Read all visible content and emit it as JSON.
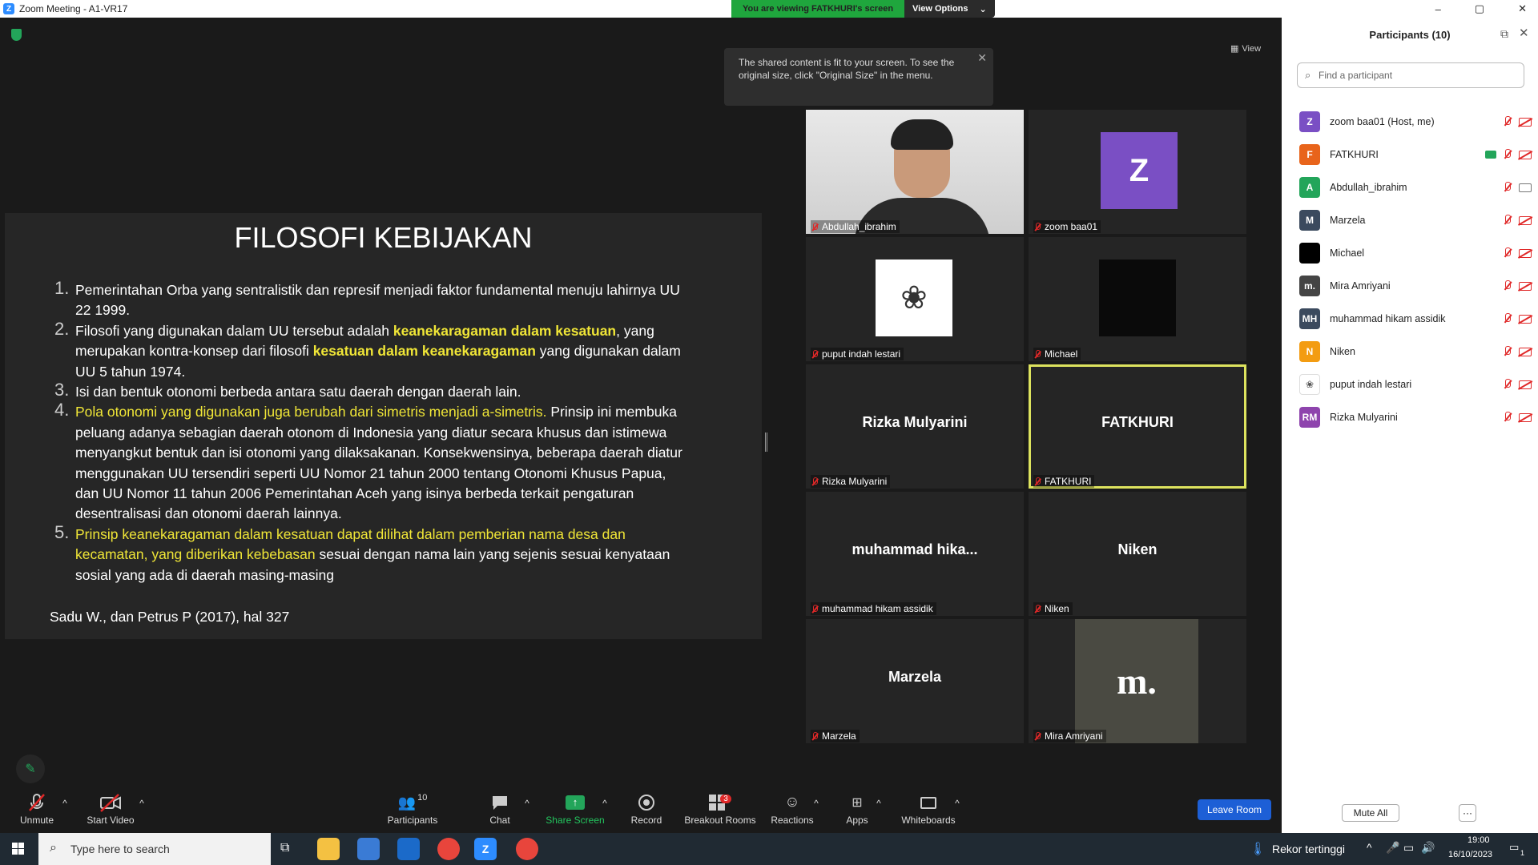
{
  "window": {
    "title": "Zoom Meeting - A1-VR17",
    "controls": {
      "minimize": "–",
      "restore": "▢",
      "close": "✕"
    }
  },
  "share_banner": {
    "status": "You are viewing FATKHURI's screen",
    "view_options": "View Options"
  },
  "tooltip": {
    "text": "The shared content is fit to your screen. To see the original size, click \"Original Size\" in the menu."
  },
  "view_button": "View",
  "slide": {
    "title": "FILOSOFI KEBIJAKAN",
    "items": [
      {
        "num": "1.",
        "segments": [
          {
            "t": "Pemerintahan Orba yang sentralistik dan represif menjadi faktor fundamental menuju lahirnya UU 22 1999.",
            "s": ""
          }
        ]
      },
      {
        "num": "2.",
        "segments": [
          {
            "t": "Filosofi yang digunakan dalam UU tersebut adalah ",
            "s": ""
          },
          {
            "t": "keanekaragaman dalam kesatuan",
            "s": "yb"
          },
          {
            "t": ", yang merupakan kontra-konsep dari filosofi ",
            "s": ""
          },
          {
            "t": "kesatuan dalam keanekaragaman",
            "s": "yb"
          },
          {
            "t": " yang digunakan dalam UU 5 tahun 1974.",
            "s": ""
          }
        ]
      },
      {
        "num": "3.",
        "segments": [
          {
            "t": "Isi dan bentuk otonomi berbeda antara satu daerah dengan daerah lain.",
            "s": ""
          }
        ]
      },
      {
        "num": "4.",
        "segments": [
          {
            "t": "Pola otonomi yang digunakan juga berubah dari simetris menjadi a-simetris.",
            "s": "y"
          },
          {
            "t": " Prinsip ini membuka peluang adanya sebagian daerah otonom di Indonesia yang diatur secara khusus dan istimewa menyangkut bentuk dan isi otonomi yang dilaksakanan.  Konsekwensinya, beberapa daerah diatur menggunakan UU tersendiri seperti UU Nomor 21 tahun 2000 tentang Otonomi Khusus Papua, dan UU Nomor 11 tahun 2006 Pemerintahan Aceh yang isinya berbeda terkait pengaturan desentralisasi dan otonomi daerah lainnya.",
            "s": ""
          }
        ]
      },
      {
        "num": "5.",
        "segments": [
          {
            "t": "Prinsip keanekaragaman dalam kesatuan dapat dilihat dalam pemberian nama desa dan kecamatan, yang diberikan kebebasan",
            "s": "y"
          },
          {
            "t": " sesuai dengan nama lain yang sejenis sesuai kenyataan sosial yang ada di daerah masing-masing",
            "s": ""
          }
        ]
      }
    ],
    "reference": "Sadu W., dan Petrus P (2017), hal 327"
  },
  "video_tiles": [
    {
      "id": "abdullah",
      "label": "Abdullah_ibrahim",
      "big": "",
      "type": "camera"
    },
    {
      "id": "zoom",
      "label": "zoom baa01",
      "big": "Z",
      "type": "avatar",
      "color": "#7a4fc4"
    },
    {
      "id": "puput",
      "label": "puput indah lestari",
      "big": "",
      "type": "image"
    },
    {
      "id": "michael",
      "label": "Michael",
      "big": "",
      "type": "black"
    },
    {
      "id": "rizka",
      "label": "Rizka Mulyarini",
      "big": "Rizka Mulyarini",
      "type": "name"
    },
    {
      "id": "fatkhuri",
      "label": "FATKHURI",
      "big": "FATKHURI",
      "type": "name"
    },
    {
      "id": "hikam",
      "label": "muhammad hikam assidik",
      "big": "muhammad  hika...",
      "type": "name"
    },
    {
      "id": "niken",
      "label": "Niken",
      "big": "Niken",
      "type": "name"
    },
    {
      "id": "marzela",
      "label": "Marzela",
      "big": "Marzela",
      "type": "name"
    },
    {
      "id": "mira",
      "label": "Mira Amriyani",
      "big": "",
      "type": "logo"
    }
  ],
  "toolbar": {
    "unmute": "Unmute",
    "start_video": "Start Video",
    "participants": "Participants",
    "participants_count": "10",
    "chat": "Chat",
    "share_screen": "Share Screen",
    "record": "Record",
    "breakout_rooms": "Breakout Rooms",
    "breakout_badge": "3",
    "reactions": "Reactions",
    "apps": "Apps",
    "whiteboards": "Whiteboards",
    "leave": "Leave Room"
  },
  "sidebar": {
    "title": "Participants (10)",
    "search_placeholder": "Find a participant",
    "mute_all": "Mute All",
    "more": "···",
    "participants": [
      {
        "initial": "Z",
        "name": "zoom baa01 (Host, me)",
        "color": "#7a4fc4",
        "cam": "off",
        "share": false
      },
      {
        "initial": "F",
        "name": "FATKHURI",
        "color": "#e8641b",
        "cam": "off",
        "share": true
      },
      {
        "initial": "A",
        "name": "Abdullah_ibrahim",
        "color": "#23a55a",
        "cam": "on",
        "share": false
      },
      {
        "initial": "M",
        "name": "Marzela",
        "color": "#3b4a5e",
        "cam": "off",
        "share": false
      },
      {
        "initial": "",
        "name": "Michael",
        "color": "#000000",
        "cam": "off",
        "share": false
      },
      {
        "initial": "m.",
        "name": "Mira Amriyani",
        "color": "#444444",
        "cam": "off",
        "share": false
      },
      {
        "initial": "MH",
        "name": "muhammad hikam assidik",
        "color": "#3b4a5e",
        "cam": "off",
        "share": false
      },
      {
        "initial": "N",
        "name": "Niken",
        "color": "#f39c12",
        "cam": "off",
        "share": false
      },
      {
        "initial": "",
        "name": "puput indah lestari",
        "color": "#ffffff",
        "cam": "off",
        "share": false
      },
      {
        "initial": "RM",
        "name": "Rizka Mulyarini",
        "color": "#8e44ad",
        "cam": "off",
        "share": false
      }
    ]
  },
  "taskbar": {
    "search_placeholder": "Type here to search",
    "weather": "Rekor tertinggi",
    "time": "19:00",
    "date": "16/10/2023",
    "notifications": "1"
  }
}
